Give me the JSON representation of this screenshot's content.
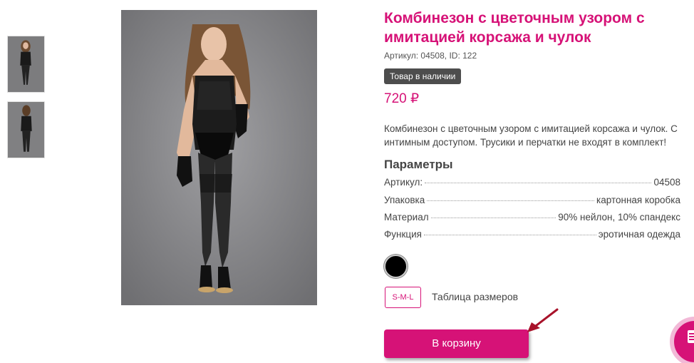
{
  "product": {
    "title": "Комбинезон с цветочным узором с имитацией корсажа и чулок",
    "sku_line": "Артикул: 04508, ID: 122",
    "stock_badge": "Товар в наличии",
    "price": "720 ₽",
    "description": "Комбинезон с цветочным узором с имитацией корсажа и чулок. С интимным доступом. Трусики и перчатки не входят в комплект!"
  },
  "parameters": {
    "heading": "Параметры",
    "rows": [
      {
        "label": "Артикул:",
        "value": "04508"
      },
      {
        "label": "Упаковка",
        "value": "картонная коробка"
      },
      {
        "label": "Материал",
        "value": "90% нейлон, 10% спандекс"
      },
      {
        "label": "Функция",
        "value": "эротичная одежда"
      }
    ]
  },
  "options": {
    "color_swatch": "#000000",
    "size_label": "S-M-L",
    "size_table_link": "Таблица размеров"
  },
  "actions": {
    "cart_button": "В корзину"
  },
  "colors": {
    "accent": "#d61277",
    "badge_bg": "#4d4d4d",
    "annotation_arrow": "#a8122a"
  },
  "icons": {
    "arrow": "annotation-arrow-icon",
    "fab": "list-icon"
  }
}
